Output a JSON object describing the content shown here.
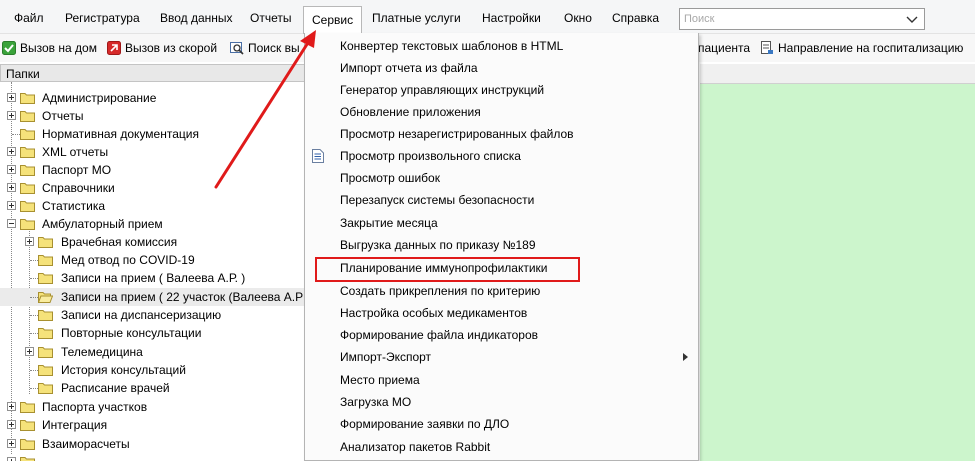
{
  "menubar": {
    "items": [
      "Файл",
      "Регистратура",
      "Ввод данных",
      "Отчеты",
      "Сервис",
      "Платные услуги",
      "Настройки",
      "Окно",
      "Справка"
    ],
    "active": "Сервис",
    "search_placeholder": "Поиск"
  },
  "toolbar": {
    "buttons": [
      {
        "label": "Вызов на дом",
        "icon": "check-icon"
      },
      {
        "label": "Вызов из скорой",
        "icon": "ambulance-call-icon"
      },
      {
        "label": "Поиск вы",
        "icon": "search-window-icon"
      },
      {
        "label": "пациента",
        "icon": ""
      },
      {
        "label": "Направление на госпитализацию",
        "icon": "referral-icon"
      }
    ]
  },
  "panel": {
    "header": "Папки",
    "tree": [
      {
        "label": "Администрирование",
        "level": 0,
        "expander": "plus"
      },
      {
        "label": "Отчеты",
        "level": 0,
        "expander": "plus"
      },
      {
        "label": "Нормативная документация",
        "level": 0,
        "expander": "none"
      },
      {
        "label": "XML отчеты",
        "level": 0,
        "expander": "plus"
      },
      {
        "label": "Паспорт МО",
        "level": 0,
        "expander": "plus"
      },
      {
        "label": "Справочники",
        "level": 0,
        "expander": "plus"
      },
      {
        "label": "Статистика",
        "level": 0,
        "expander": "plus"
      },
      {
        "label": "Амбулаторный прием",
        "level": 0,
        "expander": "minus"
      },
      {
        "label": "Врачебная комиссия",
        "level": 1,
        "expander": "plus"
      },
      {
        "label": "Мед отвод по COVID-19",
        "level": 1,
        "expander": "none"
      },
      {
        "label": "Записи на прием ( Валеева А.Р. )",
        "level": 1,
        "expander": "none"
      },
      {
        "label": "Записи на прием ( 22 участок (Валеева А.Р",
        "level": 1,
        "expander": "none",
        "selected": true
      },
      {
        "label": "Записи на диспансеризацию",
        "level": 1,
        "expander": "none"
      },
      {
        "label": "Повторные консультации",
        "level": 1,
        "expander": "none"
      },
      {
        "label": "Телемедицина",
        "level": 1,
        "expander": "plus"
      },
      {
        "label": "История консультаций",
        "level": 1,
        "expander": "none"
      },
      {
        "label": "Расписание врачей",
        "level": 1,
        "expander": "none"
      },
      {
        "label": "Паспорта участков",
        "level": 0,
        "expander": "plus"
      },
      {
        "label": "Интеграция",
        "level": 0,
        "expander": "plus"
      },
      {
        "label": "Взаиморасчеты",
        "level": 0,
        "expander": "plus"
      }
    ]
  },
  "dropdown": {
    "items": [
      {
        "label": "Конвертер текстовых шаблонов в HTML"
      },
      {
        "label": "Импорт отчета из файла"
      },
      {
        "label": "Генератор управляющих инструкций"
      },
      {
        "label": "Обновление приложения"
      },
      {
        "label": "Просмотр незарегистрированных файлов"
      },
      {
        "label": "Просмотр произвольного списка",
        "icon": "document-list-icon"
      },
      {
        "label": "Просмотр ошибок"
      },
      {
        "label": "Перезапуск системы безопасности"
      },
      {
        "label": "Закрытие месяца"
      },
      {
        "label": "Выгрузка данных по приказу №189"
      },
      {
        "label": "Планирование иммунопрофилактики",
        "highlighted": true
      },
      {
        "label": "Создать прикрепления по критерию"
      },
      {
        "label": "Настройка особых медикаментов"
      },
      {
        "label": "Формирование файла индикаторов"
      },
      {
        "label": "Импорт-Экспорт",
        "submenu": true
      },
      {
        "label": "Место приема"
      },
      {
        "label": "Загрузка МО"
      },
      {
        "label": "Формирование заявки по ДЛО"
      },
      {
        "label": "Анализатор пакетов Rabbit"
      }
    ]
  },
  "colors": {
    "content_background": "#ccf5cc",
    "annotation": "#e01a1a",
    "folder": "#f5e27a"
  }
}
